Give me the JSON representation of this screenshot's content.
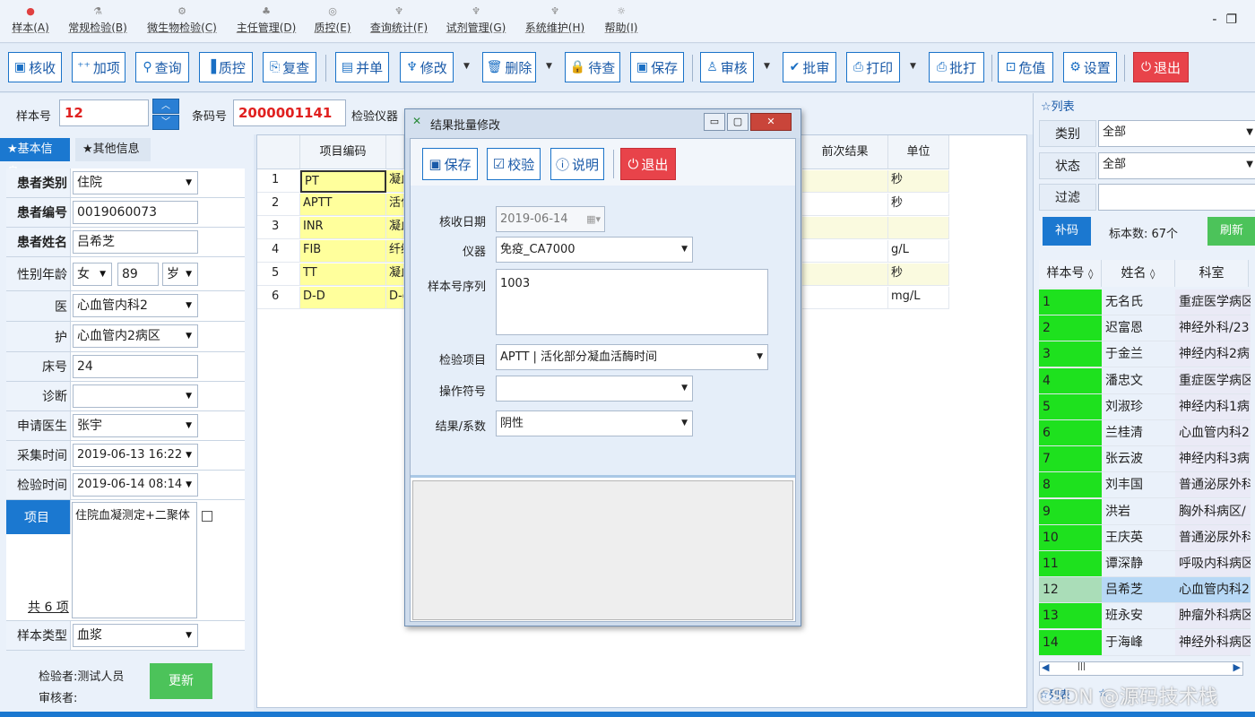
{
  "menu": [
    {
      "label": "样本(A)",
      "icon": "sample-icon"
    },
    {
      "label": "常规检验(B)",
      "icon": "test-icon"
    },
    {
      "label": "微生物检验(C)",
      "icon": "microbe-icon"
    },
    {
      "label": "主任管理(D)",
      "icon": "manager-icon"
    },
    {
      "label": "质控(E)",
      "icon": "qc-icon"
    },
    {
      "label": "查询统计(F)",
      "icon": "query-icon"
    },
    {
      "label": "试剂管理(G)",
      "icon": "reagent-icon"
    },
    {
      "label": "系统维护(H)",
      "icon": "system-icon"
    },
    {
      "label": "帮助(I)",
      "icon": "help-icon"
    }
  ],
  "toolbar": {
    "receive": "核收",
    "add": "加项",
    "query": "查询",
    "qc": "质控",
    "recheck": "复查",
    "merge": "并单",
    "modify": "修改",
    "delete": "删除",
    "pending": "待查",
    "save": "保存",
    "audit": "审核",
    "approve": "批审",
    "print": "打印",
    "batch_print": "批打",
    "critical": "危值",
    "settings": "设置",
    "exit": "退出"
  },
  "sample": {
    "no_label": "样本号",
    "no": "12",
    "barcode_label": "条码号",
    "barcode": "2000001141",
    "instrument_label": "检验仪器"
  },
  "left": {
    "tab_basic": "★基本信息",
    "tab_other": "★其他信息",
    "patient_type_label": "患者类别",
    "patient_type": "住院",
    "patient_no_label": "患者编号",
    "patient_no": "0019060073",
    "patient_name_label": "患者姓名",
    "patient_name": "吕希芝",
    "sex_age_label": "性别年龄",
    "sex": "女",
    "age": "89",
    "age_unit": "岁",
    "dept_label": "医",
    "dept": "心血管内科2",
    "ward_label": "护",
    "ward": "心血管内2病区",
    "bed_label": "床号",
    "bed": "24",
    "diag_label": "诊断",
    "diag": "",
    "doctor_label": "申请医生",
    "doctor": "张宇",
    "collect_label": "采集时间",
    "collect": "2019-06-13 16:22",
    "test_time_label": "检验时间",
    "test_time": "2019-06-14 08:14",
    "item_label": "项目",
    "items": "住院血凝测定+二聚体",
    "count_label": "共 6 项",
    "sample_type_label": "样本类型",
    "sample_type": "血浆",
    "tester_label": "检验者:测试人员",
    "reviewer_label": "审核者:",
    "update": "更新"
  },
  "grid": {
    "headers": {
      "code": "项目编码",
      "prev": "前次结果",
      "unit": "单位"
    },
    "rows": [
      {
        "n": "1",
        "code": "PT",
        "name": "凝血",
        "unit": "秒"
      },
      {
        "n": "2",
        "code": "APTT",
        "name": "活化",
        "unit": "秒"
      },
      {
        "n": "3",
        "code": "INR",
        "name": "凝血",
        "unit": ""
      },
      {
        "n": "4",
        "code": "FIB",
        "name": "纤维",
        "unit": "g/L"
      },
      {
        "n": "5",
        "code": "TT",
        "name": "凝血",
        "unit": "秒"
      },
      {
        "n": "6",
        "code": "D-D",
        "name": "D-d",
        "unit": "mg/L"
      }
    ]
  },
  "right": {
    "title": "☆列表",
    "category_label": "类别",
    "category": "全部",
    "status_label": "状态",
    "status": "全部",
    "filter_label": "过滤",
    "filter": "",
    "fill_code": "补码",
    "count_text": "标本数: 67个",
    "refresh": "刷新",
    "headers": {
      "no": "样本号",
      "name": "姓名",
      "dept": "科室"
    },
    "rows": [
      {
        "no": "1",
        "name": "无名氏",
        "dept": "重症医学病区"
      },
      {
        "no": "2",
        "name": "迟富恩",
        "dept": "神经外科/23"
      },
      {
        "no": "3",
        "name": "于金兰",
        "dept": "神经内科2病"
      },
      {
        "no": "4",
        "name": "潘忠文",
        "dept": "重症医学病区"
      },
      {
        "no": "5",
        "name": "刘淑珍",
        "dept": "神经内科1病"
      },
      {
        "no": "6",
        "name": "兰桂清",
        "dept": "心血管内科2"
      },
      {
        "no": "7",
        "name": "张云波",
        "dept": "神经内科3病"
      },
      {
        "no": "8",
        "name": "刘丰国",
        "dept": "普通泌尿外科"
      },
      {
        "no": "9",
        "name": "洪岩",
        "dept": "胸外科病区/"
      },
      {
        "no": "10",
        "name": "王庆英",
        "dept": "普通泌尿外科"
      },
      {
        "no": "11",
        "name": "谭深静",
        "dept": "呼吸内科病区"
      },
      {
        "no": "12",
        "name": "吕希芝",
        "dept": "心血管内科2"
      },
      {
        "no": "13",
        "name": "班永安",
        "dept": "肿瘤外科病区"
      },
      {
        "no": "14",
        "name": "于海峰",
        "dept": "神经外科病区"
      }
    ],
    "tab_list": "☆列表",
    "tab_other": "☆",
    "watermark": "CSDN @源码技术栈"
  },
  "dialog": {
    "title": "结果批量修改",
    "save": "保存",
    "check": "校验",
    "explain": "说明",
    "exit": "退出",
    "date_label": "核收日期",
    "date": "2019-06-14",
    "instrument_label": "仪器",
    "instrument": "免疫_CA7000",
    "seq_label": "样本号序列",
    "seq": "1003",
    "item_label": "检验项目",
    "item": "APTT | 活化部分凝血活酶时间",
    "op_label": "操作符号",
    "op": "",
    "result_label": "结果/系数",
    "result": "阴性"
  }
}
